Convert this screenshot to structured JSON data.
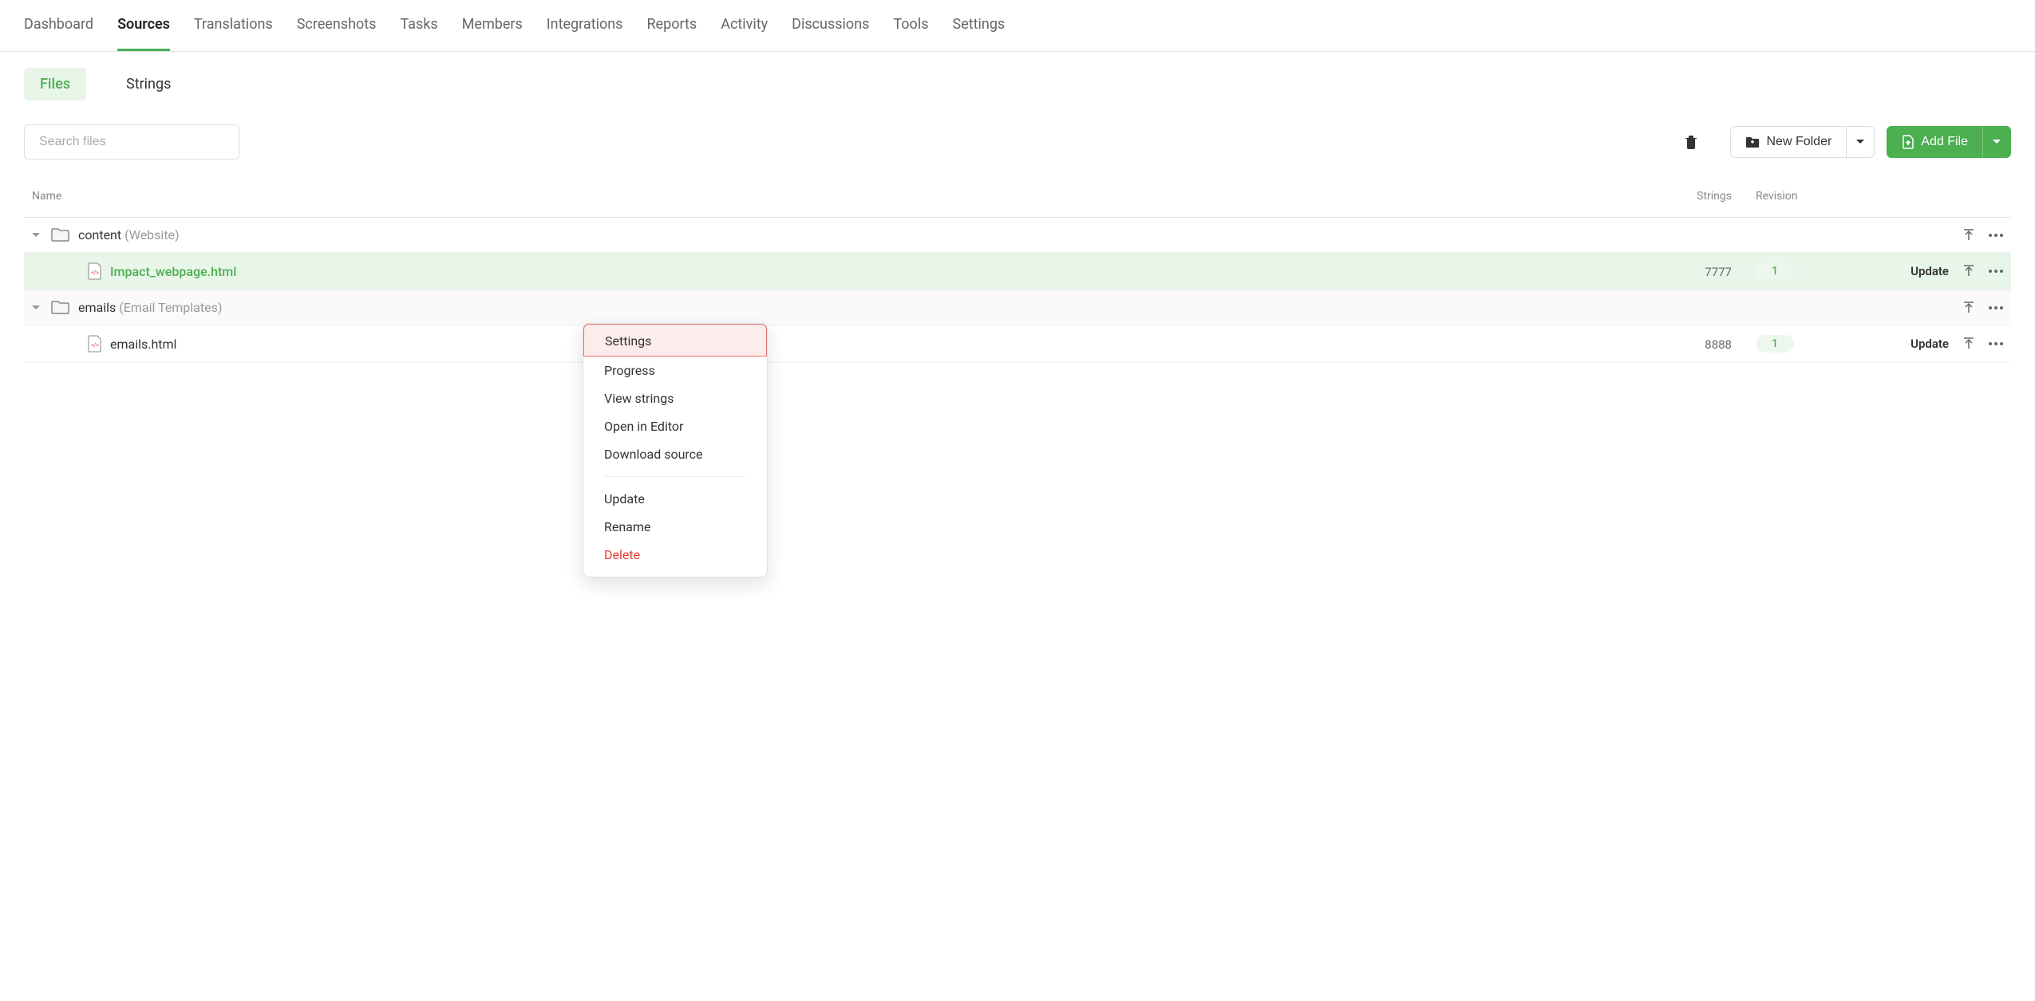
{
  "top_nav": {
    "items": [
      "Dashboard",
      "Sources",
      "Translations",
      "Screenshots",
      "Tasks",
      "Members",
      "Integrations",
      "Reports",
      "Activity",
      "Discussions",
      "Tools",
      "Settings"
    ],
    "active_index": 1
  },
  "sub_tabs": {
    "items": [
      "Files",
      "Strings"
    ],
    "active_index": 0
  },
  "toolbar": {
    "search_placeholder": "Search files",
    "new_folder_label": "New Folder",
    "add_file_label": "Add File"
  },
  "table": {
    "headers": {
      "name": "Name",
      "strings": "Strings",
      "revision": "Revision"
    },
    "rows": [
      {
        "type": "folder",
        "name": "content",
        "description": "(Website)"
      },
      {
        "type": "file",
        "name": "Impact_webpage.html",
        "strings": "7777",
        "revision": "1",
        "update_label": "Update",
        "highlighted": true
      },
      {
        "type": "folder",
        "name": "emails",
        "description": "(Email Templates)"
      },
      {
        "type": "file",
        "name": "emails.html",
        "strings": "8888",
        "revision": "1",
        "update_label": "Update",
        "highlighted": false
      }
    ]
  },
  "context_menu": {
    "items": [
      {
        "label": "Settings",
        "highlight": true
      },
      {
        "label": "Progress"
      },
      {
        "label": "View strings"
      },
      {
        "label": "Open in Editor"
      },
      {
        "label": "Download source"
      },
      {
        "divider": true
      },
      {
        "label": "Update"
      },
      {
        "label": "Rename"
      },
      {
        "label": "Delete",
        "danger": true
      }
    ]
  }
}
